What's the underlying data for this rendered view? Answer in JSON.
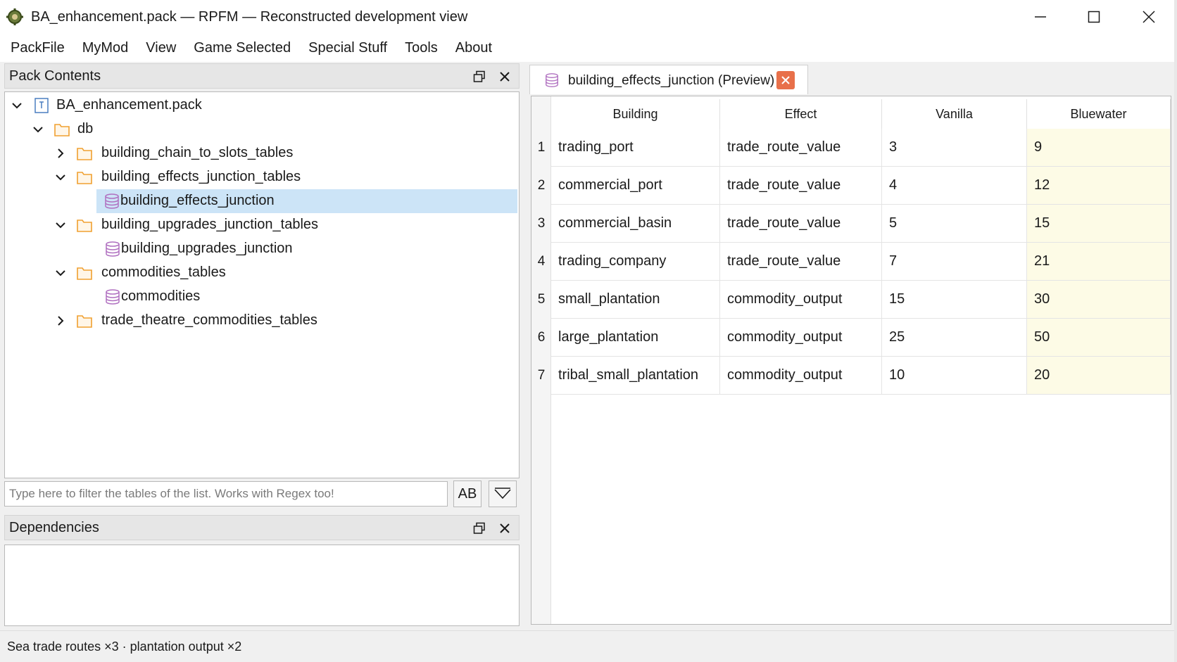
{
  "window": {
    "title": "BA_enhancement.pack — RPFM — Reconstructed development view",
    "app_icon": "rpfm-gear-icon"
  },
  "menu": [
    "PackFile",
    "MyMod",
    "View",
    "Game Selected",
    "Special Stuff",
    "Tools",
    "About"
  ],
  "pack_contents": {
    "title": "Pack Contents",
    "tree": [
      {
        "label": "BA_enhancement.pack",
        "icon": "pack-icon",
        "expanded": true
      },
      {
        "label": "db",
        "icon": "folder-icon",
        "expanded": true
      },
      {
        "label": "building_chain_to_slots_tables",
        "icon": "folder-icon",
        "expanded": false
      },
      {
        "label": "building_effects_junction_tables",
        "icon": "folder-icon",
        "expanded": true
      },
      {
        "label": "building_effects_junction",
        "icon": "db-table-icon",
        "selected": true
      },
      {
        "label": "building_upgrades_junction_tables",
        "icon": "folder-icon",
        "expanded": true
      },
      {
        "label": "building_upgrades_junction",
        "icon": "db-table-icon"
      },
      {
        "label": "commodities_tables",
        "icon": "folder-icon",
        "expanded": true
      },
      {
        "label": "commodities",
        "icon": "db-table-icon"
      },
      {
        "label": "trade_theatre_commodities_tables",
        "icon": "folder-icon",
        "expanded": false
      }
    ],
    "filter_placeholder": "Type here to filter the tables of the list. Works with Regex too!",
    "case_button": "AB"
  },
  "dependencies": {
    "title": "Dependencies"
  },
  "editor": {
    "tab_label": "building_effects_junction (Preview)",
    "columns": [
      "Building",
      "Effect",
      "Vanilla",
      "Bluewater"
    ],
    "rows": [
      {
        "n": "1",
        "building": "trading_port",
        "effect": "trade_route_value",
        "vanilla": "3",
        "bluewater": "9"
      },
      {
        "n": "2",
        "building": "commercial_port",
        "effect": "trade_route_value",
        "vanilla": "4",
        "bluewater": "12"
      },
      {
        "n": "3",
        "building": "commercial_basin",
        "effect": "trade_route_value",
        "vanilla": "5",
        "bluewater": "15"
      },
      {
        "n": "4",
        "building": "trading_company",
        "effect": "trade_route_value",
        "vanilla": "7",
        "bluewater": "21"
      },
      {
        "n": "5",
        "building": "small_plantation",
        "effect": "commodity_output",
        "vanilla": "15",
        "bluewater": "30"
      },
      {
        "n": "6",
        "building": "large_plantation",
        "effect": "commodity_output",
        "vanilla": "25",
        "bluewater": "50"
      },
      {
        "n": "7",
        "building": "tribal_small_plantation",
        "effect": "commodity_output",
        "vanilla": "10",
        "bluewater": "20"
      }
    ]
  },
  "status": {
    "text": "Sea trade routes ×3  ·  plantation output ×2"
  },
  "colors": {
    "selection": "#cce4f7",
    "folder": "#f0a030",
    "db_icon": "#b070c0",
    "tab_close": "#e8704a",
    "highlight_column": "#fdfbe6"
  }
}
